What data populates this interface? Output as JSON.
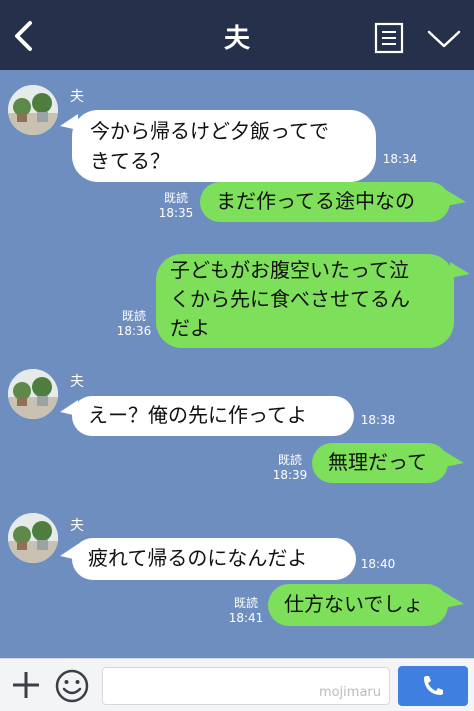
{
  "header": {
    "title": "夫",
    "back_icon": "chevron-left-icon",
    "menu_icon": "note-list-icon",
    "expand_icon": "chevron-down-icon"
  },
  "messages": [
    {
      "side": "in",
      "sender": "夫",
      "lines": [
        "今から帰るけど夕飯ってで",
        "きてる？"
      ],
      "time": "18:34"
    },
    {
      "side": "out",
      "read": "既読",
      "lines": [
        "まだ作ってる途中なの"
      ],
      "time": "18:35"
    },
    {
      "side": "out",
      "read": "既読",
      "lines": [
        "子どもがお腹空いたって泣",
        "くから先に食べさせてるん",
        "だよ"
      ],
      "time": "18:36"
    },
    {
      "side": "in",
      "sender": "夫",
      "lines": [
        "えー？俺の先に作ってよ"
      ],
      "time": "18:38"
    },
    {
      "side": "out",
      "read": "既読",
      "lines": [
        "無理だって"
      ],
      "time": "18:39"
    },
    {
      "side": "in",
      "sender": "夫",
      "lines": [
        "疲れて帰るのになんだよ"
      ],
      "time": "18:40"
    },
    {
      "side": "out",
      "read": "既読",
      "lines": [
        "仕方ないでしょ"
      ],
      "time": "18:41"
    }
  ],
  "footer": {
    "plus_icon": "plus-icon",
    "emoji_icon": "smiley-icon",
    "watermark": "mojimaru",
    "call_icon": "phone-icon"
  },
  "colors": {
    "chat_background": "#6f8ec0",
    "header_background": "#25304a",
    "incoming_bubble": "#ffffff",
    "outgoing_bubble": "#7ee05a",
    "send_button": "#3f7fe0"
  }
}
